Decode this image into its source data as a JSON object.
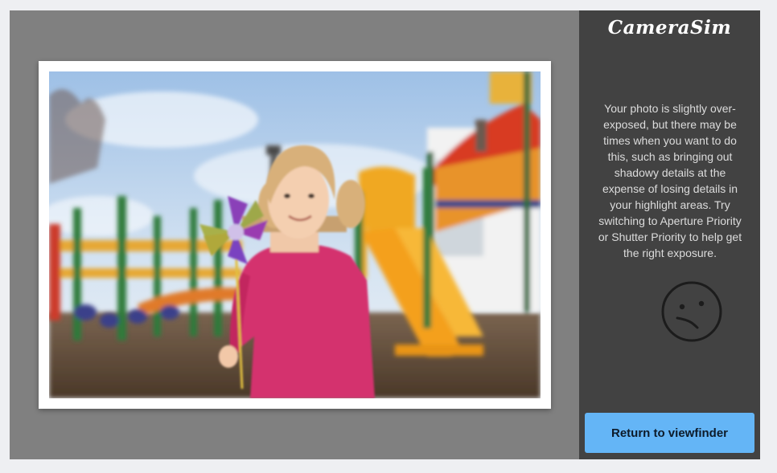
{
  "app": {
    "logo_text": "CameraSim"
  },
  "feedback": {
    "message": "Your photo is slightly over-exposed, but there may be times when you want to do this, such as bringing out shadowy details at the expense of losing details in your highlight areas. Try switching to Aperture Priority or Shutter Priority to help get the right exposure.",
    "mood_icon": "confused-face-icon"
  },
  "actions": {
    "return_label": "Return to viewfinder"
  },
  "colors": {
    "stage_bg": "#808080",
    "panel_bg": "#424242",
    "button_bg": "#64b5f6"
  }
}
